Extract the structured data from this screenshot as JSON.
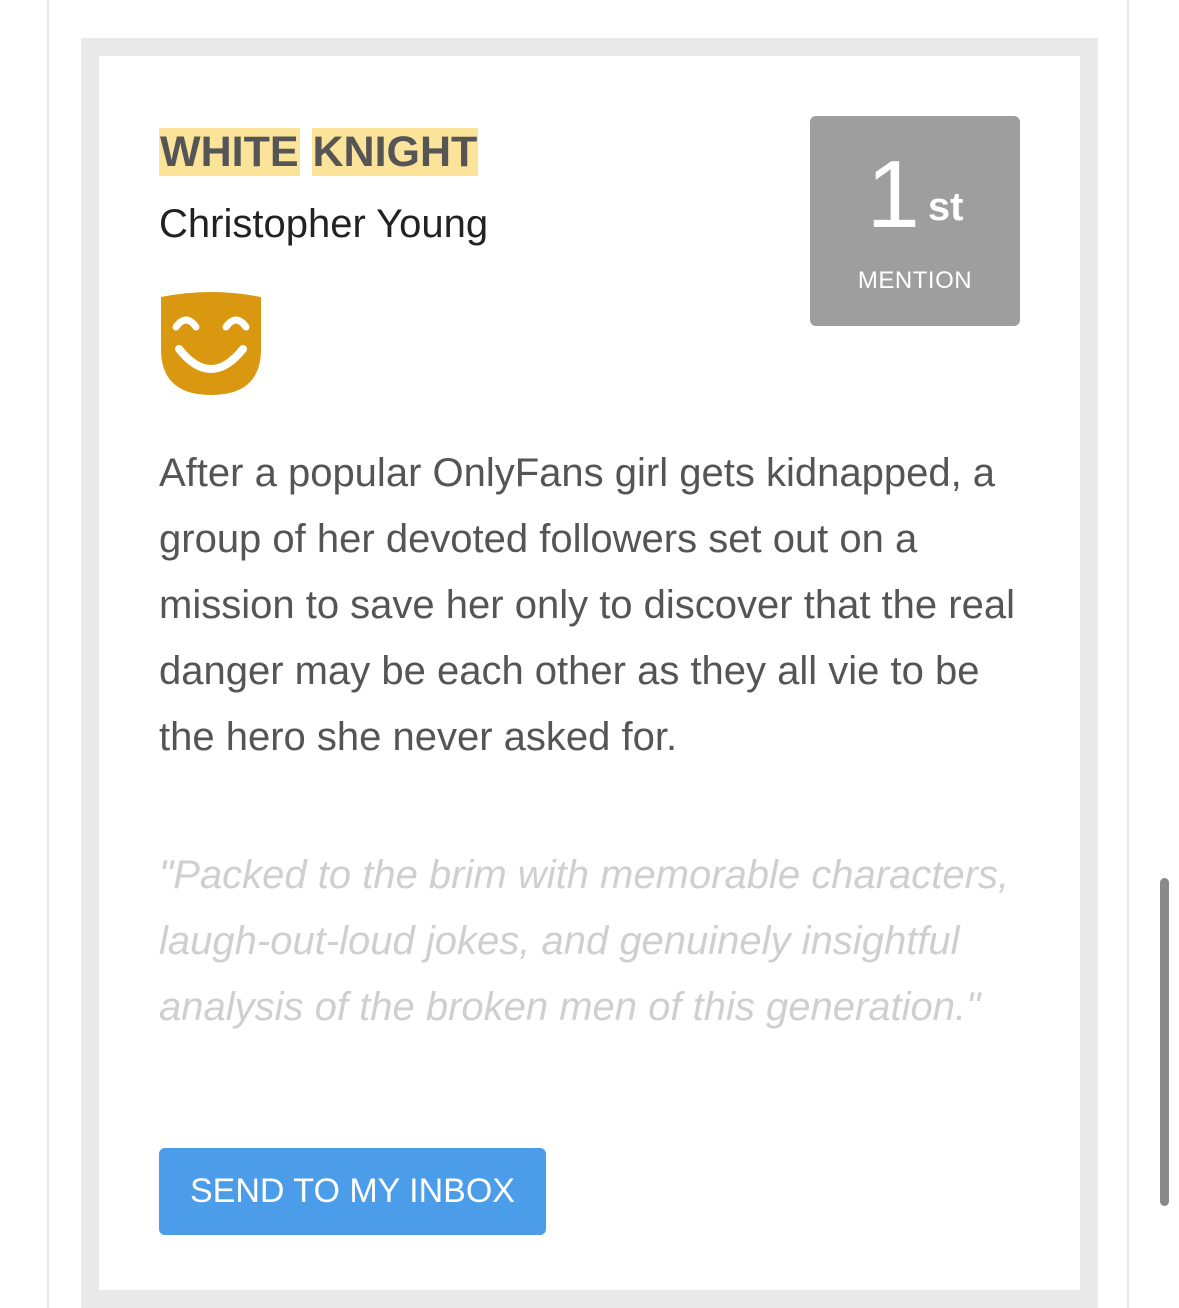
{
  "card": {
    "title_words": [
      "WHITE",
      "KNIGHT"
    ],
    "author": "Christopher Young",
    "icon": "comedy-mask-icon",
    "rank": {
      "number": "1",
      "suffix": "st",
      "label": "MENTION"
    },
    "description": "After a popular OnlyFans girl gets kidnapped, a group of her devoted followers set out on a mission to save her only to discover that the real danger may be each other as they all vie to be the hero she never asked for.",
    "quote": "\"Packed to the brim with memorable characters, laugh-out-loud jokes, and genuinely insightful analysis of the broken men of this generation.\"",
    "button_label": "SEND TO MY INBOX"
  },
  "colors": {
    "title_highlight": "#fbe39a",
    "badge_bg": "#9e9e9e",
    "mask": "#d9980f",
    "button_bg": "#4b9de9",
    "quote_text": "#cfcfcf",
    "body_text": "#555555"
  }
}
